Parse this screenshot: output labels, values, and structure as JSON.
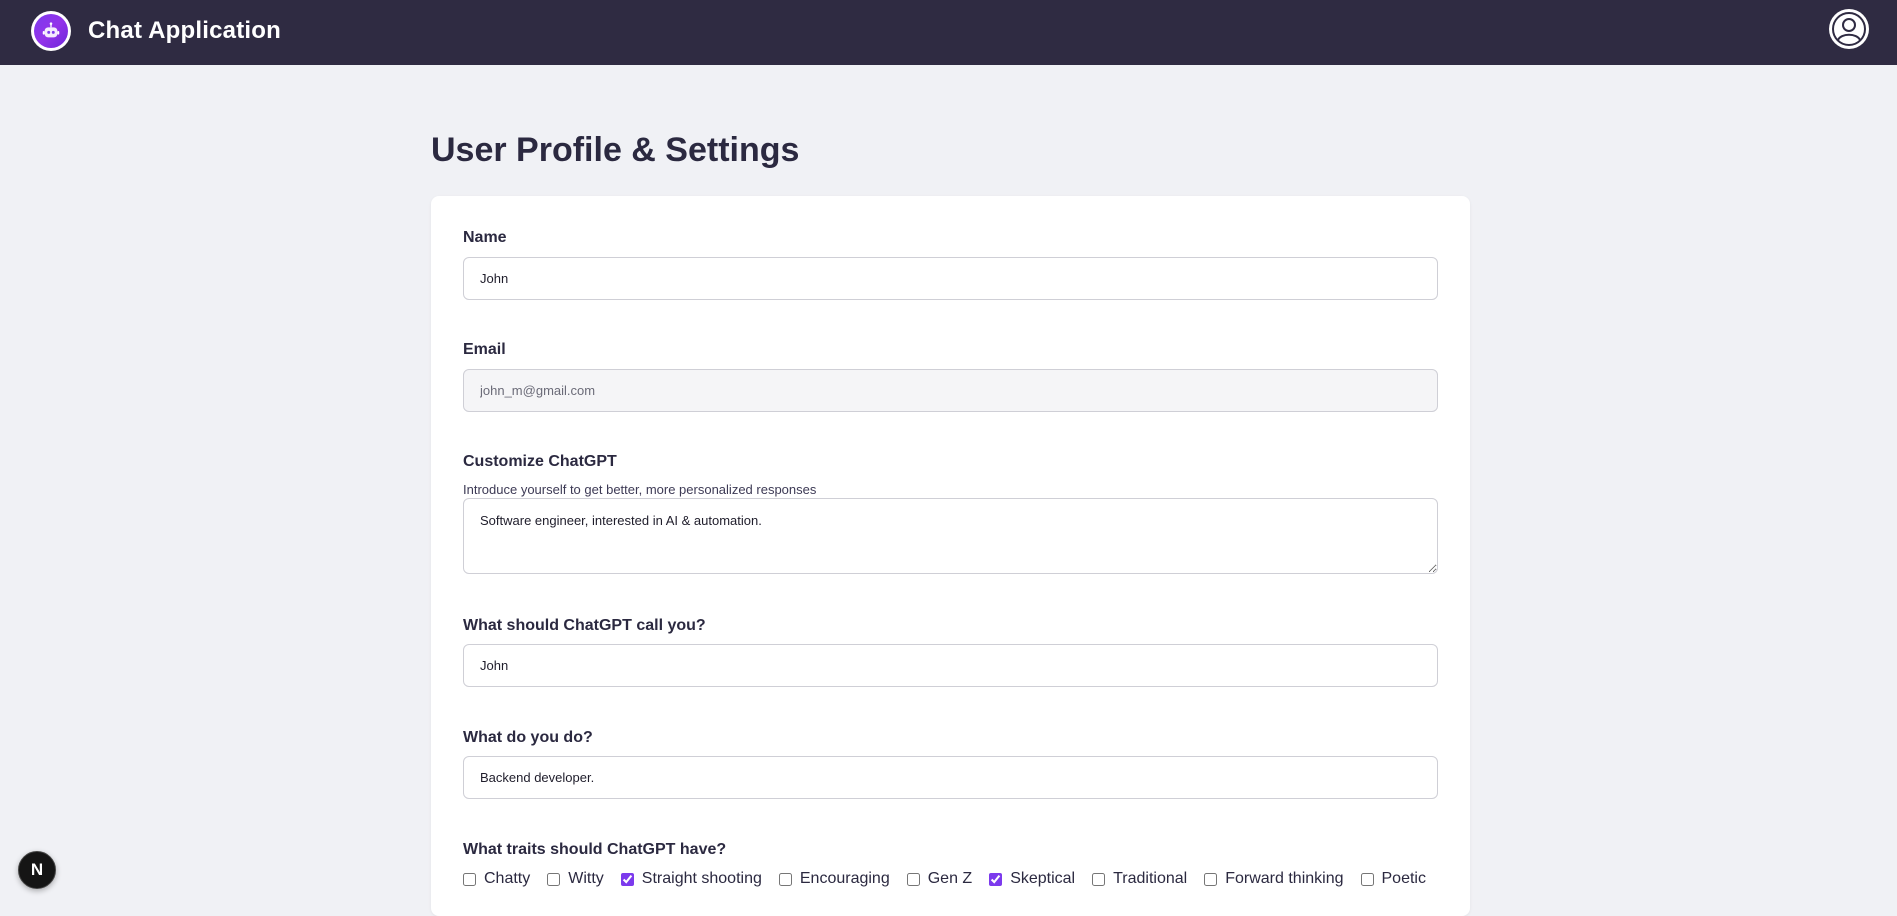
{
  "app": {
    "title": "Chat Application"
  },
  "page": {
    "title": "User Profile & Settings"
  },
  "form": {
    "name": {
      "label": "Name",
      "value": "John"
    },
    "email": {
      "label": "Email",
      "value": "john_m@gmail.com"
    },
    "customize": {
      "label": "Customize ChatGPT",
      "hint": "Introduce yourself to get better, more personalized responses",
      "value": "Software engineer, interested in AI & automation."
    },
    "nickname": {
      "label": "What should ChatGPT call you?",
      "value": "John"
    },
    "occupation": {
      "label": "What do you do?",
      "value": "Backend developer."
    },
    "traits": {
      "label": "What traits should ChatGPT have?",
      "options": [
        {
          "label": "Chatty",
          "checked": false
        },
        {
          "label": "Witty",
          "checked": false
        },
        {
          "label": "Straight shooting",
          "checked": true
        },
        {
          "label": "Encouraging",
          "checked": false
        },
        {
          "label": "Gen Z",
          "checked": false
        },
        {
          "label": "Skeptical",
          "checked": true
        },
        {
          "label": "Traditional",
          "checked": false
        },
        {
          "label": "Forward thinking",
          "checked": false
        },
        {
          "label": "Poetic",
          "checked": false
        }
      ]
    }
  },
  "badge": {
    "label": "N"
  },
  "icons": {
    "logo": "robot-icon",
    "avatar": "user-circle-icon"
  },
  "colors": {
    "navbar": "#2f2b42",
    "accent": "#7c3aed",
    "background": "#f0f1f5"
  }
}
